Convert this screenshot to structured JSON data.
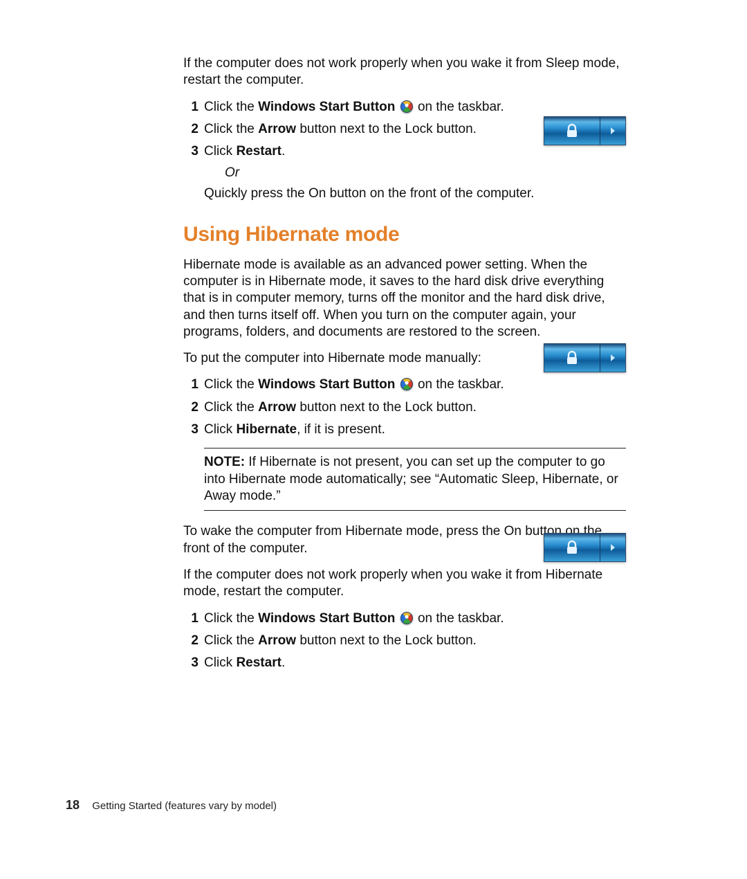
{
  "intro_sleep_restart": "If the computer does not work properly when you wake it from Sleep mode, restart the computer.",
  "steps_restart_a": {
    "s1": {
      "num": "1",
      "pre": "Click the ",
      "bold": "Windows Start Button",
      "post": " on the taskbar."
    },
    "s2": {
      "num": "2",
      "pre": "Click the ",
      "bold": "Arrow",
      "post": " button next to the Lock button."
    },
    "s3": {
      "num": "3",
      "pre": "Click ",
      "bold": "Restart",
      "post": "."
    },
    "or": "Or",
    "alt": "Quickly press the On button on the front of the computer."
  },
  "hibernate": {
    "heading": "Using Hibernate mode",
    "desc": "Hibernate mode is available as an advanced power setting. When the computer is in Hibernate mode, it saves to the hard disk drive everything that is in computer memory, turns off the monitor and the hard disk drive, and then turns itself off. When you turn on the computer again, your programs, folders, and documents are restored to the screen.",
    "lead": "To put the computer into Hibernate mode manually:",
    "steps": {
      "s1": {
        "num": "1",
        "pre": "Click the ",
        "bold": "Windows Start Button",
        "post": " on the taskbar."
      },
      "s2": {
        "num": "2",
        "pre": "Click the ",
        "bold": "Arrow",
        "post": " button next to the Lock button."
      },
      "s3": {
        "num": "3",
        "pre": "Click ",
        "bold": "Hibernate",
        "post": ", if it is present."
      }
    },
    "note_label": "NOTE:",
    "note_body": " If Hibernate is not present, you can set up the computer to go into Hibernate mode automatically; see “Automatic Sleep, Hibernate, or Away mode.”",
    "wake": "To wake the computer from Hibernate mode, press the On button on the front of the computer.",
    "restart_intro": "If the computer does not work properly when you wake it from Hibernate mode, restart the computer.",
    "steps_restart": {
      "s1": {
        "num": "1",
        "pre": "Click the ",
        "bold": "Windows Start Button",
        "post": " on the taskbar."
      },
      "s2": {
        "num": "2",
        "pre": "Click the ",
        "bold": "Arrow",
        "post": " button next to the Lock button."
      },
      "s3": {
        "num": "3",
        "pre": "Click ",
        "bold": "Restart",
        "post": "."
      }
    }
  },
  "footer": {
    "page": "18",
    "text": "Getting Started (features vary by model)"
  }
}
